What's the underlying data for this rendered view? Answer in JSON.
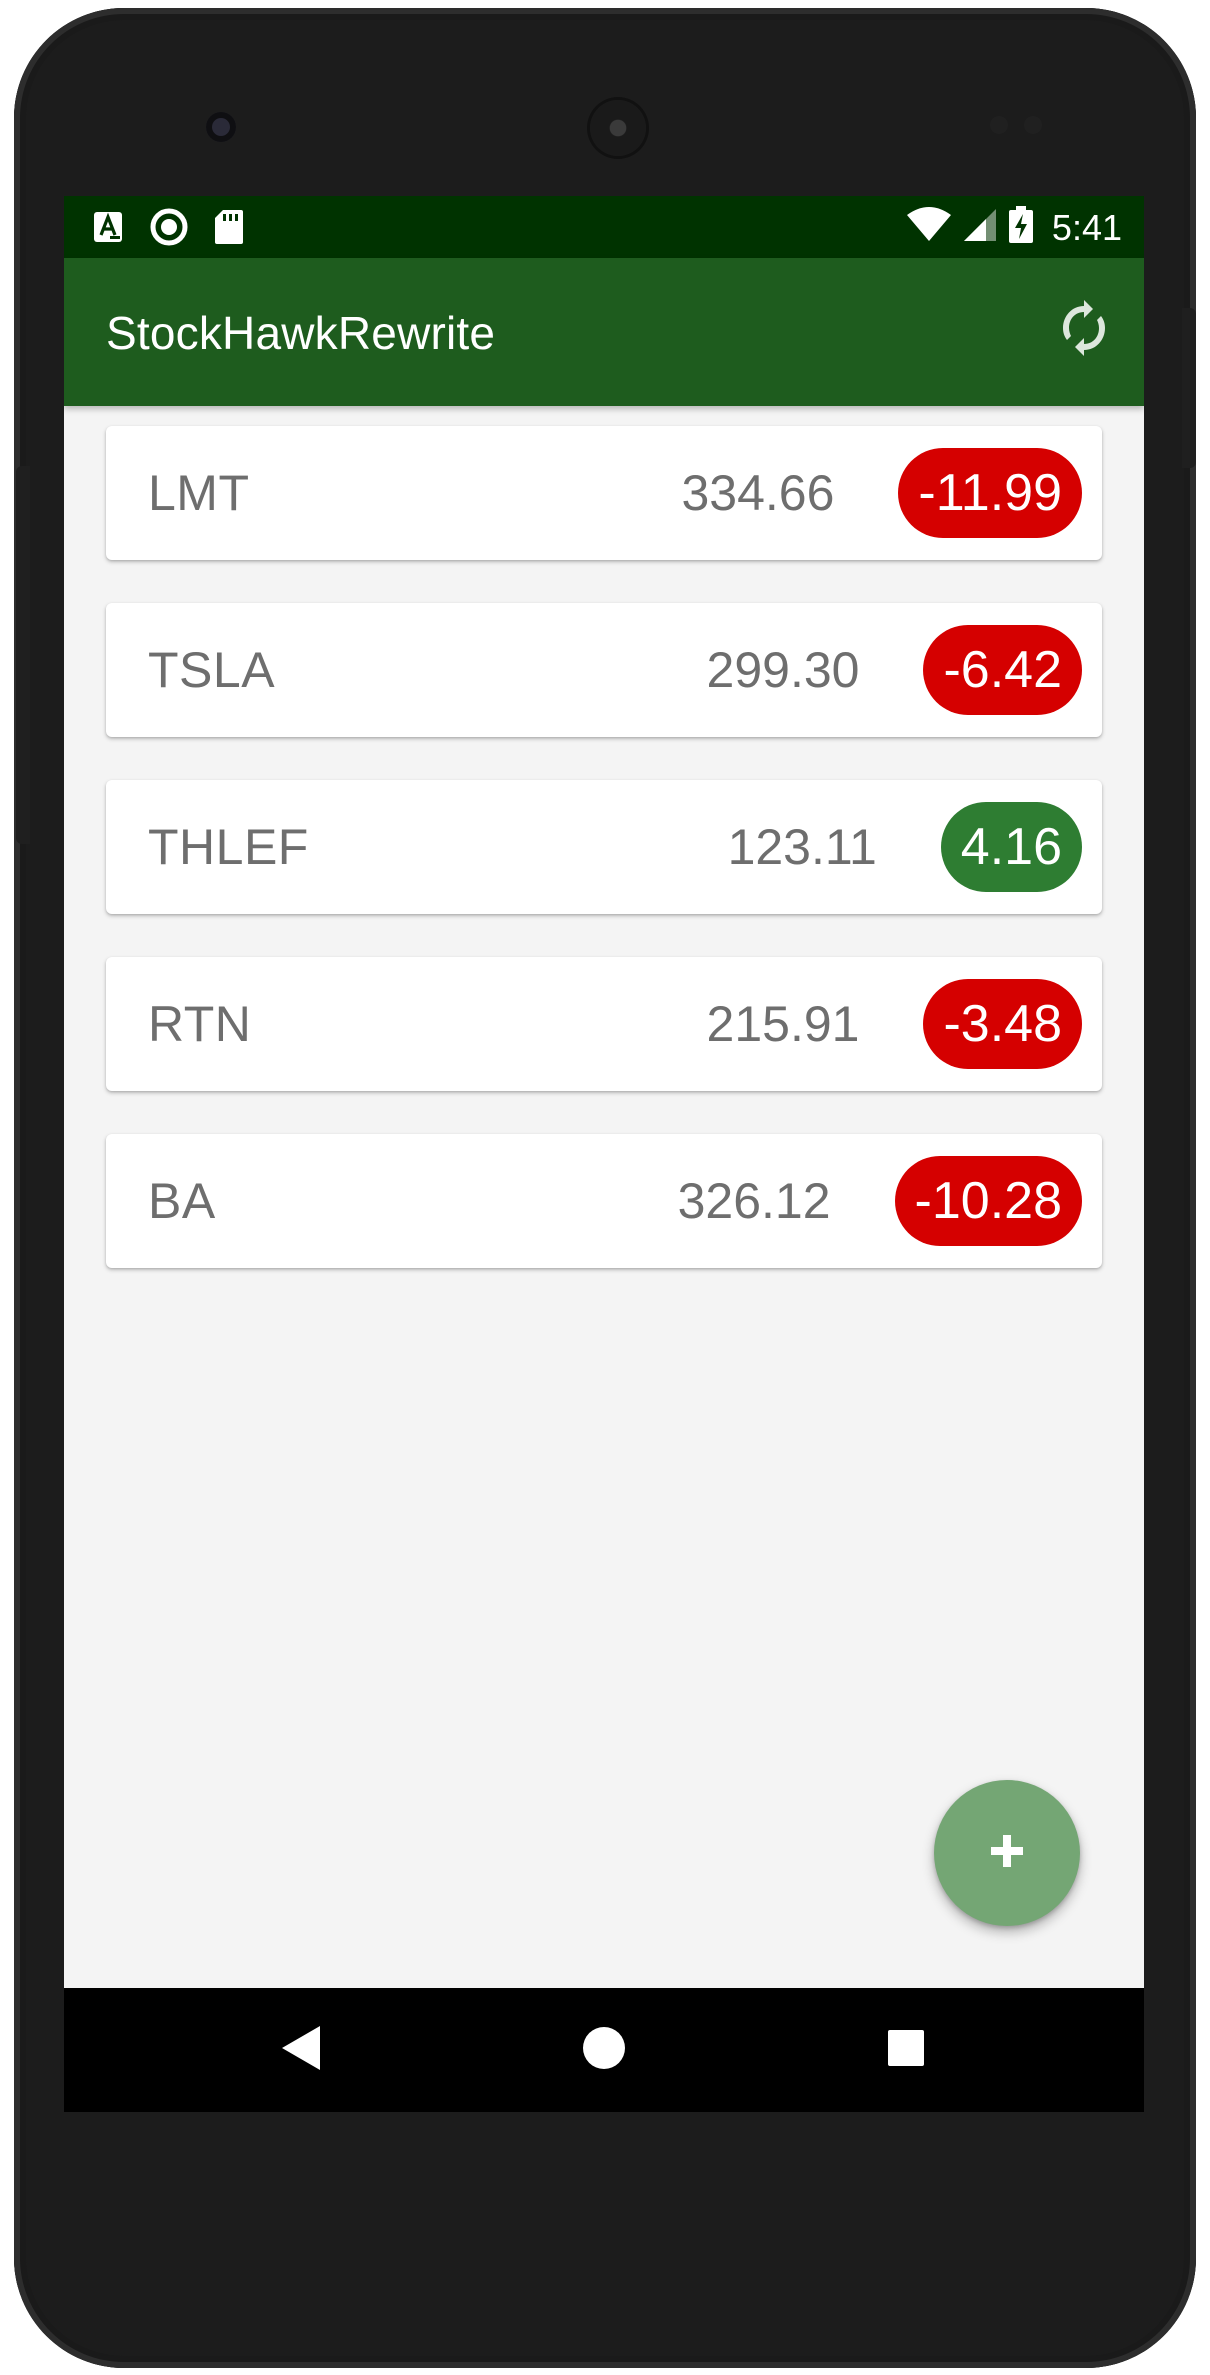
{
  "status_bar": {
    "time": "5:41",
    "background": "#003300",
    "icons": [
      "font-notification-icon",
      "sync-notification-icon",
      "sd-card-icon",
      "wifi-icon",
      "cell-signal-icon",
      "battery-charging-icon"
    ]
  },
  "app_bar": {
    "title": "StockHawkRewrite",
    "background": "#1e5c1e",
    "action_icon": "refresh-icon"
  },
  "stocks": [
    {
      "symbol": "LMT",
      "price": "334.66",
      "change": "-11.99",
      "direction": "down"
    },
    {
      "symbol": "TSLA",
      "price": "299.30",
      "change": "-6.42",
      "direction": "down"
    },
    {
      "symbol": "THLEF",
      "price": "123.11",
      "change": "4.16",
      "direction": "up"
    },
    {
      "symbol": "RTN",
      "price": "215.91",
      "change": "-3.48",
      "direction": "down"
    },
    {
      "symbol": "BA",
      "price": "326.12",
      "change": "-10.28",
      "direction": "down"
    }
  ],
  "colors": {
    "negative_change": "#d50000",
    "positive_change": "#2e7d32",
    "fab": "#74a674",
    "list_background": "#f4f4f4"
  },
  "fab": {
    "icon": "plus-icon"
  },
  "nav_bar": {
    "buttons": [
      "back-icon",
      "home-icon",
      "recents-icon"
    ]
  }
}
